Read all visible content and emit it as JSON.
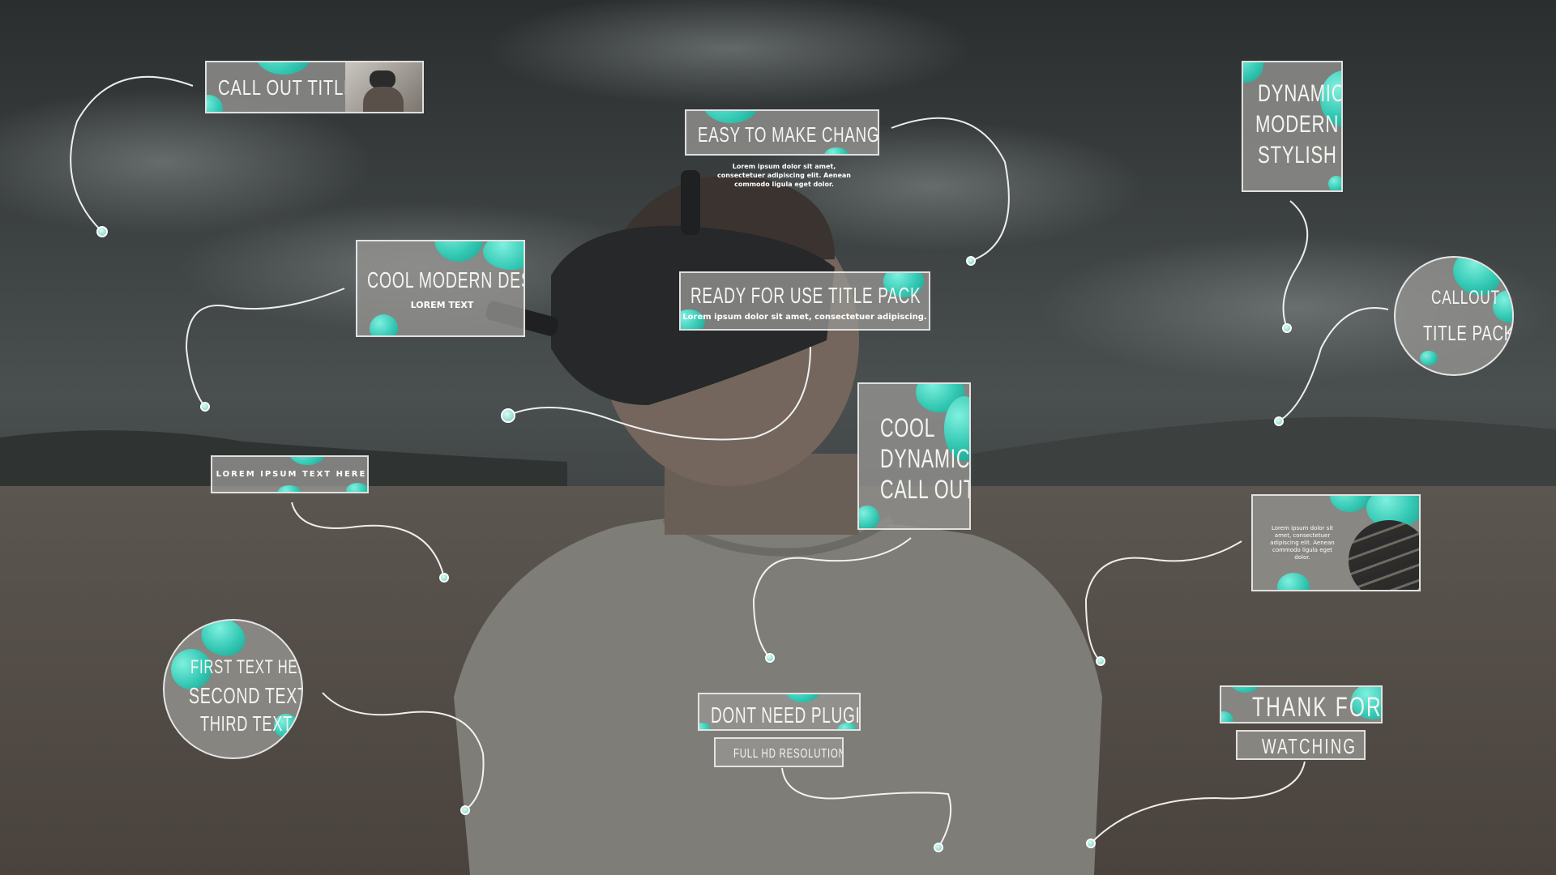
{
  "callouts": {
    "call_out_title": "CALL OUT TITLE",
    "easy_changes": "EASY TO MAKE CHANGES",
    "easy_changes_body": "Lorem ipsum dolor sit amet, consectetuer adipiscing elit. Aenean commodo ligula eget dolor.",
    "dynamic_lines": [
      "DYNAMIC",
      "MODERN",
      "STYLISH"
    ],
    "cool_modern": "COOL MODERN DESIGN",
    "lorem_text": "LOREM TEXT",
    "ready_left": "READY FOR USE",
    "ready_right": "TITLE PACK",
    "ready_body": "Lorem ipsum dolor sit amet, consectetuer adipiscing.",
    "callout_pack_lines": [
      "CALLOUT",
      "TITLE PACK"
    ],
    "lorem_ipsum_bar": "LOREM IPSUM TEXT HERE",
    "cool_dynamic_lines": [
      "COOL",
      "DYNAMIC",
      "CALL OUT"
    ],
    "image_card_body": "Lorem ipsum dolor sit amet, consectetuer adipiscing elit. Aenean commodo ligula eget dolor.",
    "first_circle_lines": [
      "FIRST TEXT HERE",
      "SECOND TEXT",
      "THIRD TEXT"
    ],
    "dont_need_plugins": "DONT NEED PLUGINS",
    "full_hd": "FULL HD RESOLUTION",
    "thank_for": "THANK FOR",
    "watching": "WATCHING"
  },
  "colors": {
    "accent": "#34c9b4",
    "panel": "#969692",
    "sky": "#2f3333",
    "ground": "#6a625a"
  }
}
